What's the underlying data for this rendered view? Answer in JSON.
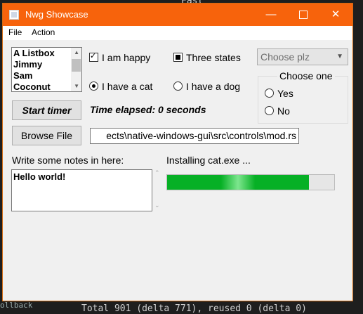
{
  "background": {
    "top_text": "Fast",
    "bottom_text": "Total 901 (delta 771), reused 0 (delta 0)",
    "left_text": "ollback"
  },
  "window": {
    "title": "Nwg Showcase",
    "accent_color": "#f7630c",
    "controls": {
      "minimize": "—",
      "close": "✕"
    }
  },
  "menu": {
    "items": [
      "File",
      "Action"
    ]
  },
  "listbox": {
    "items": [
      "A Listbox",
      "Jimmy",
      "Sam",
      "Coconut"
    ]
  },
  "checkboxes": {
    "happy": {
      "label": "I am happy",
      "state": "checked"
    },
    "three_states": {
      "label": "Three states",
      "state": "indeterminate"
    }
  },
  "combo": {
    "placeholder": "Choose plz"
  },
  "radios_pets": {
    "cat": {
      "label": "I have a cat",
      "selected": true
    },
    "dog": {
      "label": "I have a dog",
      "selected": false
    }
  },
  "group": {
    "title": "Choose one",
    "yes": {
      "label": "Yes",
      "selected": false
    },
    "no": {
      "label": "No",
      "selected": false
    }
  },
  "timer": {
    "button_label": "Start timer",
    "status": "Time elapsed: 0 seconds"
  },
  "browse": {
    "button_label": "Browse File",
    "path": "ects\\native-windows-gui\\src\\controls\\mod.rs"
  },
  "notes": {
    "label": "Write some notes in here:",
    "value": "Hello world!"
  },
  "install": {
    "label": "Installing cat.exe ...",
    "progress_percent": 85,
    "progress_color": "#06b025"
  }
}
